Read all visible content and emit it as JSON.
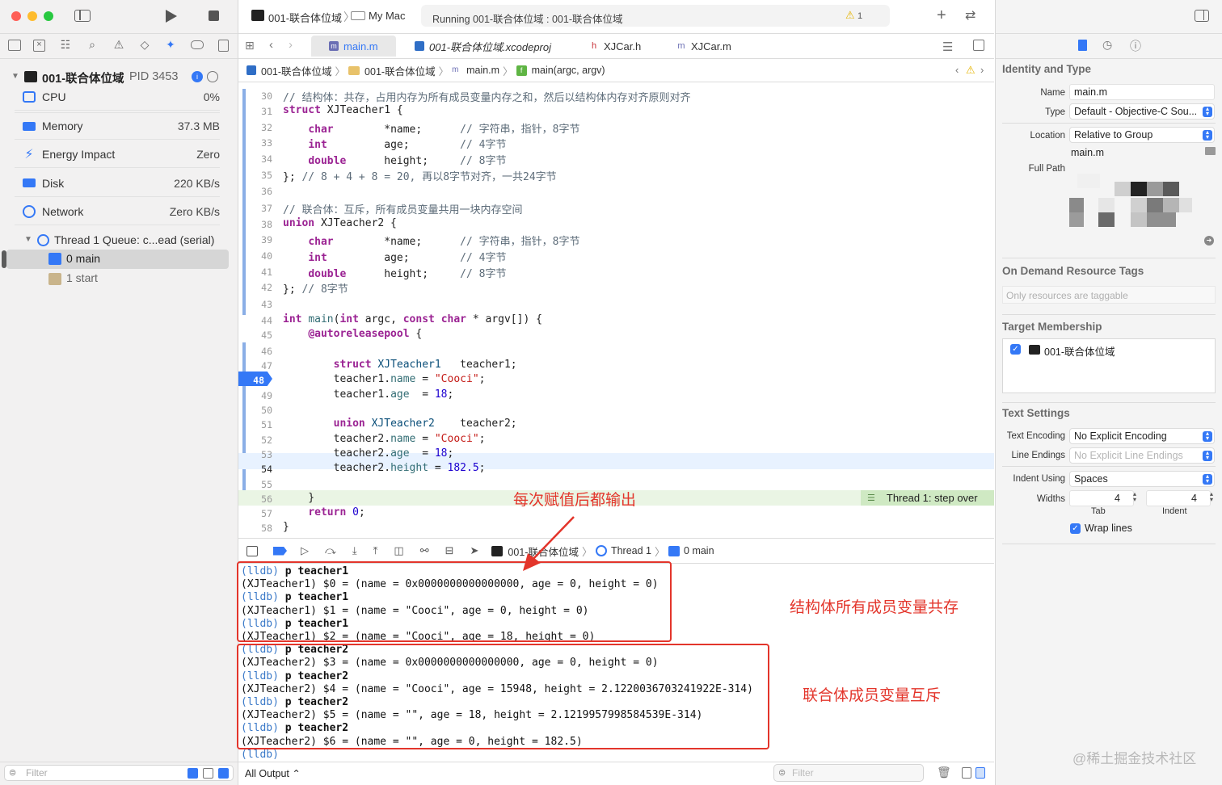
{
  "window": {
    "scheme": "001-联合体位域",
    "destination": "My Mac",
    "status": "Running 001-联合体位域 : 001-联合体位域",
    "warnings": "1"
  },
  "debug_nav": {
    "process": "001-联合体位域",
    "pid": "PID 3453",
    "gauges": [
      {
        "label": "CPU",
        "value": "0%",
        "icon": "cpu-icon"
      },
      {
        "label": "Memory",
        "value": "37.3 MB",
        "icon": "memory-icon"
      },
      {
        "label": "Energy Impact",
        "value": "Zero",
        "icon": "energy-icon"
      },
      {
        "label": "Disk",
        "value": "220 KB/s",
        "icon": "disk-icon"
      },
      {
        "label": "Network",
        "value": "Zero KB/s",
        "icon": "network-icon"
      }
    ],
    "thread": "Thread 1 Queue: c...ead (serial)",
    "frames": [
      "0 main",
      "1 start"
    ],
    "filter_placeholder": "Filter"
  },
  "tabs": [
    {
      "label": "main.m",
      "active": true
    },
    {
      "label": "001-联合体位域.xcodeproj",
      "active": false
    },
    {
      "label": "XJCar.h",
      "active": false
    },
    {
      "label": "XJCar.m",
      "active": false
    }
  ],
  "jumpbar": [
    "001-联合体位域",
    "001-联合体位域",
    "main.m",
    "main(argc, argv)"
  ],
  "code": {
    "line_numbers": [
      "30",
      "31",
      "32",
      "33",
      "34",
      "35",
      "36",
      "37",
      "38",
      "39",
      "40",
      "41",
      "42",
      "43",
      "44",
      "45",
      "46",
      "47",
      "48",
      "49",
      "50",
      "51",
      "52",
      "53",
      "54",
      "55",
      "56",
      "57",
      "58"
    ],
    "current_line": "48",
    "step_label": "Thread 1: step over"
  },
  "debug_bar": {
    "path": [
      "001-联合体位域",
      "Thread 1",
      "0 main"
    ]
  },
  "console": {
    "lines": [
      {
        "p": "(lldb)",
        "t": " p teacher1"
      },
      {
        "p": "",
        "t": "(XJTeacher1) $0 = (name = 0x0000000000000000, age = 0, height = 0)"
      },
      {
        "p": "(lldb)",
        "t": " p teacher1"
      },
      {
        "p": "",
        "t": "(XJTeacher1) $1 = (name = \"Cooci\", age = 0, height = 0)"
      },
      {
        "p": "(lldb)",
        "t": " p teacher1"
      },
      {
        "p": "",
        "t": "(XJTeacher1) $2 = (name = \"Cooci\", age = 18, height = 0)"
      },
      {
        "p": "(lldb)",
        "t": " p teacher2"
      },
      {
        "p": "",
        "t": "(XJTeacher2) $3 = (name = 0x0000000000000000, age = 0, height = 0)"
      },
      {
        "p": "(lldb)",
        "t": " p teacher2"
      },
      {
        "p": "",
        "t": "(XJTeacher2) $4 = (name = \"Cooci\", age = 15948, height = 2.1220036703241922E-314)"
      },
      {
        "p": "(lldb)",
        "t": " p teacher2"
      },
      {
        "p": "",
        "t": "(XJTeacher2) $5 = (name = \"\", age = 18, height = 2.1219957998584539E-314)"
      },
      {
        "p": "(lldb)",
        "t": " p teacher2"
      },
      {
        "p": "",
        "t": "(XJTeacher2) $6 = (name = \"\", age = 0, height = 182.5)"
      },
      {
        "p": "(lldb)",
        "t": ""
      }
    ],
    "output_selector": "All Output ⌃",
    "filter_placeholder": "Filter"
  },
  "annotations": {
    "arrow_note": "每次赋值后都输出",
    "struct_note": "结构体所有成员变量共存",
    "union_note": "联合体成员变量互斥"
  },
  "inspector": {
    "identity_title": "Identity and Type",
    "name_label": "Name",
    "name_value": "main.m",
    "type_label": "Type",
    "type_value": "Default - Objective-C Sou...",
    "location_label": "Location",
    "location_value": "Relative to Group",
    "location_file": "main.m",
    "fullpath_label": "Full Path",
    "odr_title": "On Demand Resource Tags",
    "odr_placeholder": "Only resources are taggable",
    "target_title": "Target Membership",
    "target_name": "001-联合体位域",
    "text_title": "Text Settings",
    "encoding_label": "Text Encoding",
    "encoding_value": "No Explicit Encoding",
    "endings_label": "Line Endings",
    "endings_value": "No Explicit Line Endings",
    "indent_label": "Indent Using",
    "indent_value": "Spaces",
    "widths_label": "Widths",
    "tab_value": "4",
    "indent_width_value": "4",
    "tab_label": "Tab",
    "indent_col_label": "Indent",
    "wrap_label": "Wrap lines"
  },
  "watermark": "@稀土掘金技术社区",
  "colors": {
    "accent": "#3478f6",
    "annotation": "#e3352b",
    "current_line": "#e8f2ff",
    "step_line": "#eaf5e4"
  }
}
